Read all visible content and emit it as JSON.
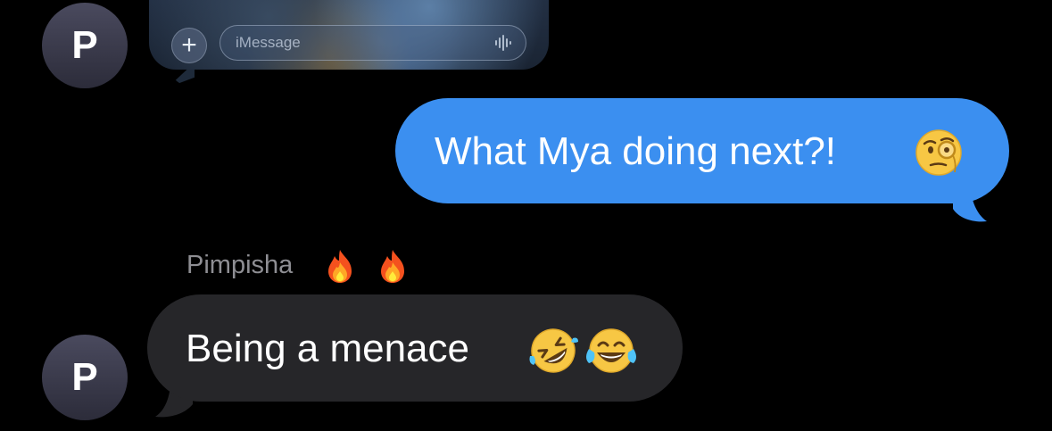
{
  "conversation": {
    "contact_initial": "P",
    "sender_name": "Pimpisha",
    "sender_name_emojis": [
      "fire-icon",
      "fire-icon"
    ]
  },
  "image_preview": {
    "add_button_label": "+",
    "input_placeholder": "iMessage",
    "voice_icon": "waveform-icon"
  },
  "messages": [
    {
      "direction": "outgoing",
      "text": "What Mya doing next?!",
      "emojis": [
        "face-with-monocle"
      ]
    },
    {
      "direction": "incoming",
      "text": "Being a menace",
      "emojis": [
        "rolling-on-floor-laughing",
        "face-with-tears-of-joy"
      ]
    }
  ],
  "colors": {
    "background": "#000000",
    "outgoing_bubble": "#3b8ff0",
    "incoming_bubble": "#262629",
    "sender_name": "#8e8e93"
  }
}
